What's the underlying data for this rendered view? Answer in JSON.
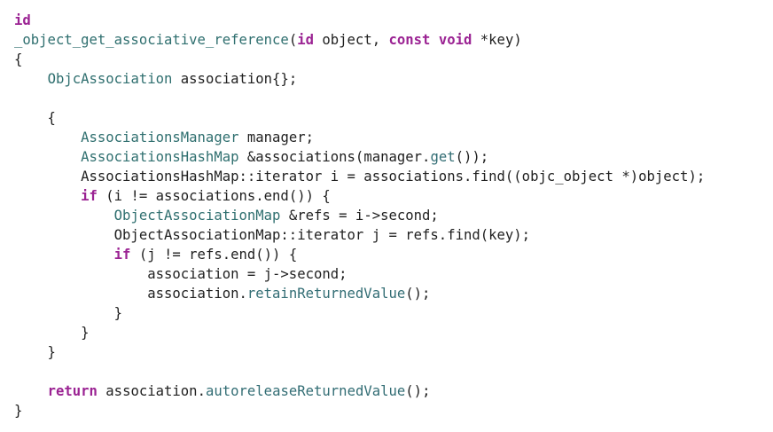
{
  "colors": {
    "background": "#ffffff",
    "plain": "#1f1f1f",
    "keyword": "#9b2393",
    "type": "#2f6f6f",
    "function": "#326d74"
  },
  "code": {
    "lines": [
      [
        [
          "kw",
          "id"
        ]
      ],
      [
        [
          "ty",
          "_object_get_associative_reference"
        ],
        [
          "pl",
          "("
        ],
        [
          "kw",
          "id"
        ],
        [
          "pl",
          " object, "
        ],
        [
          "kw",
          "const"
        ],
        [
          "pl",
          " "
        ],
        [
          "kw",
          "void"
        ],
        [
          "pl",
          " *key)"
        ]
      ],
      [
        [
          "pl",
          "{"
        ]
      ],
      [
        [
          "pl",
          "    "
        ],
        [
          "ty",
          "ObjcAssociation"
        ],
        [
          "pl",
          " association{};"
        ]
      ],
      [],
      [
        [
          "pl",
          "    {"
        ]
      ],
      [
        [
          "pl",
          "        "
        ],
        [
          "ty",
          "AssociationsManager"
        ],
        [
          "pl",
          " manager;"
        ]
      ],
      [
        [
          "pl",
          "        "
        ],
        [
          "ty",
          "AssociationsHashMap"
        ],
        [
          "pl",
          " &associations(manager."
        ],
        [
          "fn",
          "get"
        ],
        [
          "pl",
          "());"
        ]
      ],
      [
        [
          "pl",
          "        AssociationsHashMap::iterator i = associations.find((objc_object *)object);"
        ]
      ],
      [
        [
          "pl",
          "        "
        ],
        [
          "kw",
          "if"
        ],
        [
          "pl",
          " (i != associations.end()) {"
        ]
      ],
      [
        [
          "pl",
          "            "
        ],
        [
          "ty",
          "ObjectAssociationMap"
        ],
        [
          "pl",
          " &refs = i->second;"
        ]
      ],
      [
        [
          "pl",
          "            ObjectAssociationMap::iterator j = refs.find(key);"
        ]
      ],
      [
        [
          "pl",
          "            "
        ],
        [
          "kw",
          "if"
        ],
        [
          "pl",
          " (j != refs.end()) {"
        ]
      ],
      [
        [
          "pl",
          "                association = j->second;"
        ]
      ],
      [
        [
          "pl",
          "                association."
        ],
        [
          "fn",
          "retainReturnedValue"
        ],
        [
          "pl",
          "();"
        ]
      ],
      [
        [
          "pl",
          "            }"
        ]
      ],
      [
        [
          "pl",
          "        }"
        ]
      ],
      [
        [
          "pl",
          "    }"
        ]
      ],
      [],
      [
        [
          "pl",
          "    "
        ],
        [
          "kw",
          "return"
        ],
        [
          "pl",
          " association."
        ],
        [
          "fn",
          "autoreleaseReturnedValue"
        ],
        [
          "pl",
          "();"
        ]
      ],
      [
        [
          "pl",
          "}"
        ]
      ]
    ]
  }
}
